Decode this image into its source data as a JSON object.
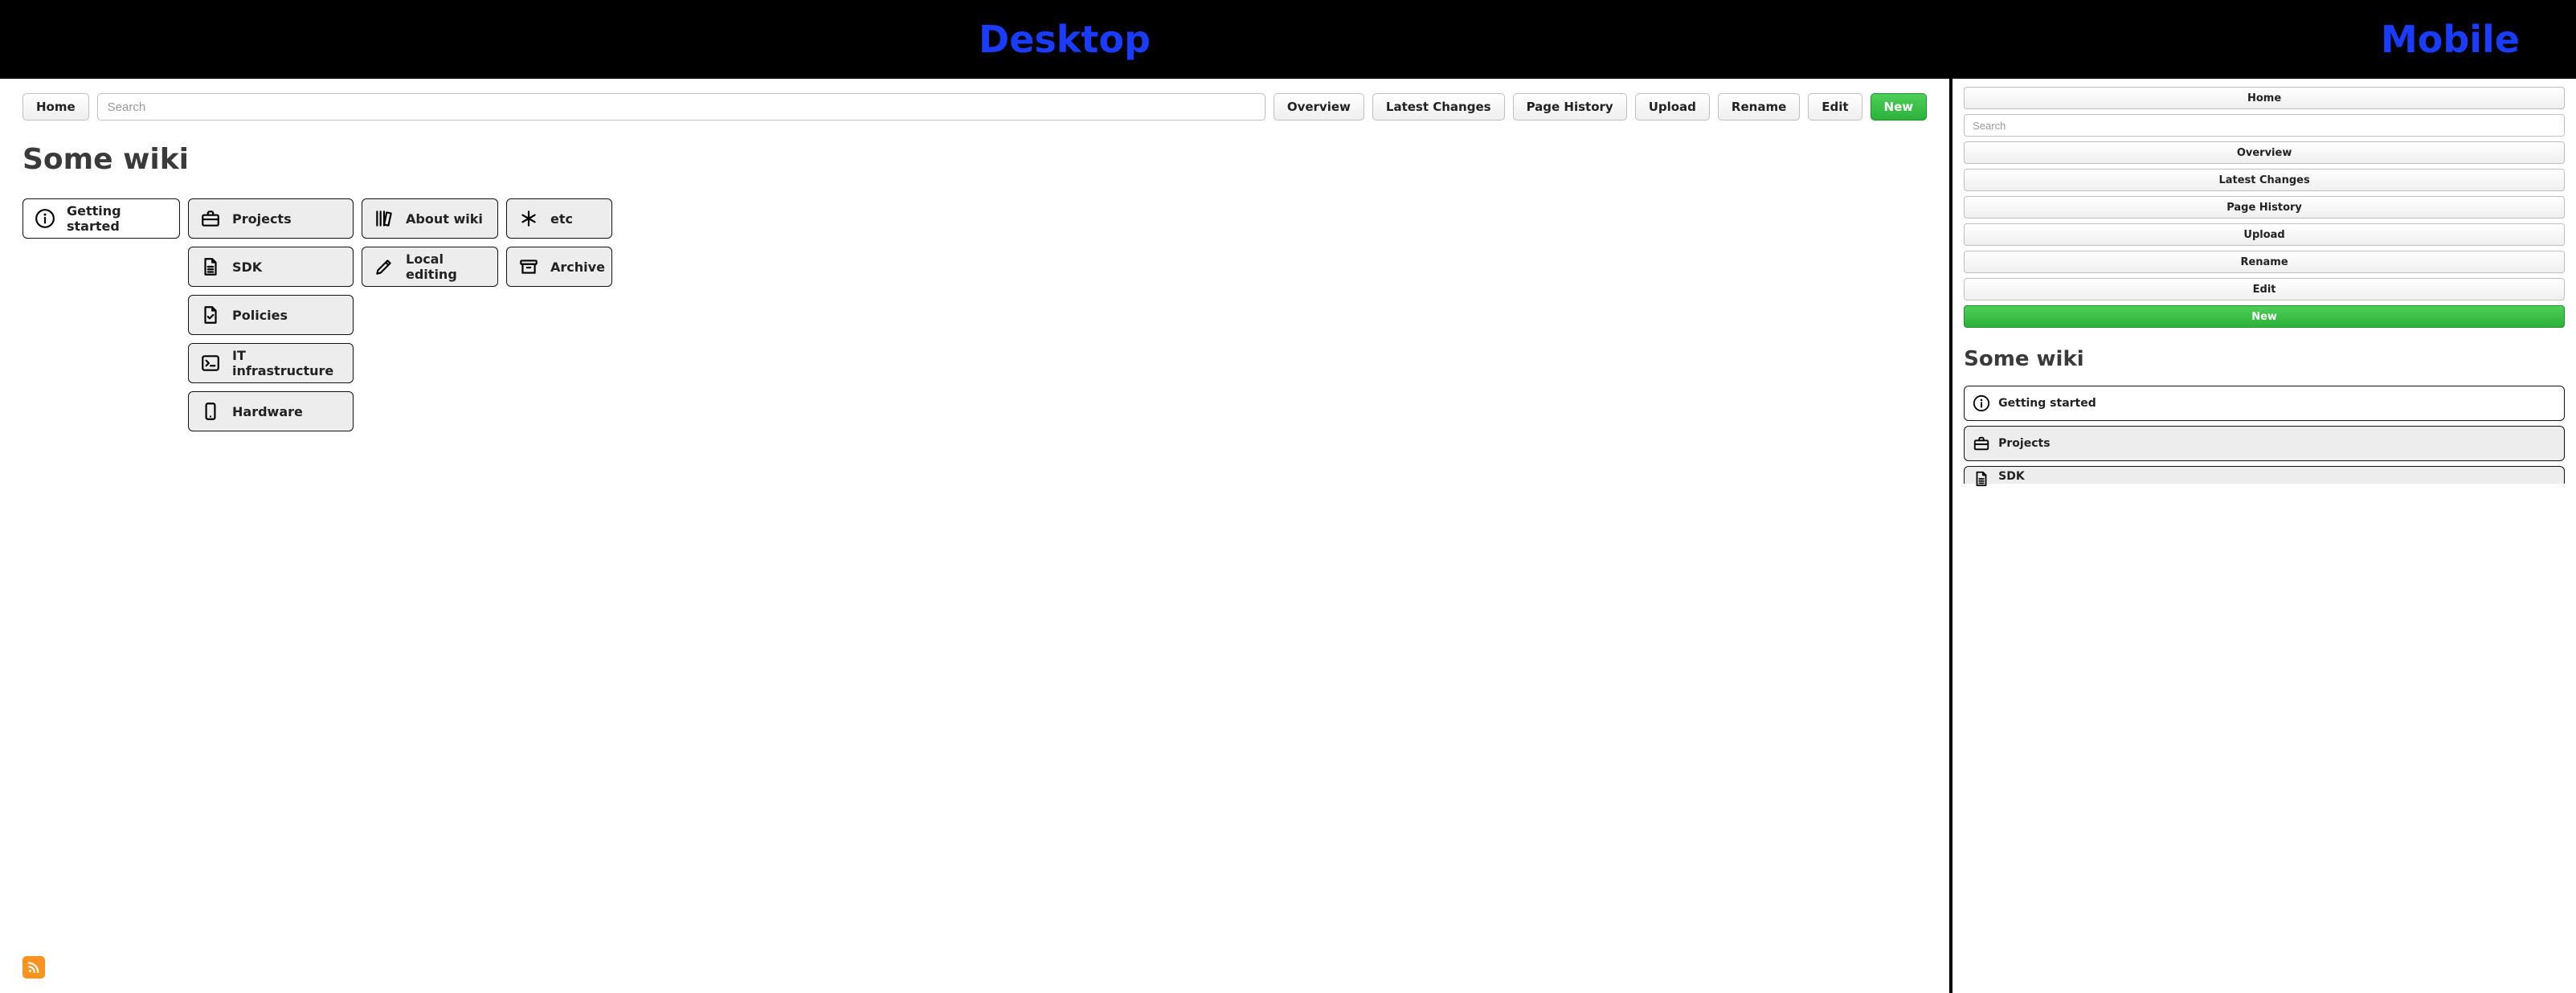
{
  "banner": {
    "desktop_label": "Desktop",
    "mobile_label": "Mobile"
  },
  "toolbar": {
    "home": "Home",
    "search_placeholder": "Search",
    "overview": "Overview",
    "latest_changes": "Latest Changes",
    "page_history": "Page History",
    "upload": "Upload",
    "rename": "Rename",
    "edit": "Edit",
    "new": "New"
  },
  "page": {
    "title": "Some wiki"
  },
  "tiles": {
    "col0": [
      {
        "icon": "info",
        "label": "Getting started",
        "bg": "white"
      }
    ],
    "col1": [
      {
        "icon": "briefcase",
        "label": "Projects"
      },
      {
        "icon": "doc-lines",
        "label": "SDK"
      },
      {
        "icon": "doc-check",
        "label": "Policies"
      },
      {
        "icon": "terminal",
        "label": "IT infrastructure"
      },
      {
        "icon": "phone",
        "label": "Hardware"
      }
    ],
    "col2": [
      {
        "icon": "books",
        "label": "About wiki"
      },
      {
        "icon": "pencil",
        "label": "Local editing"
      }
    ],
    "col3": [
      {
        "icon": "asterisk",
        "label": "etc"
      },
      {
        "icon": "archive",
        "label": "Archive"
      }
    ]
  },
  "mobile_tiles": [
    {
      "icon": "info",
      "label": "Getting started",
      "bg": "white"
    },
    {
      "icon": "briefcase",
      "label": "Projects"
    },
    {
      "icon": "doc-lines",
      "label": "SDK",
      "cut": true
    }
  ]
}
